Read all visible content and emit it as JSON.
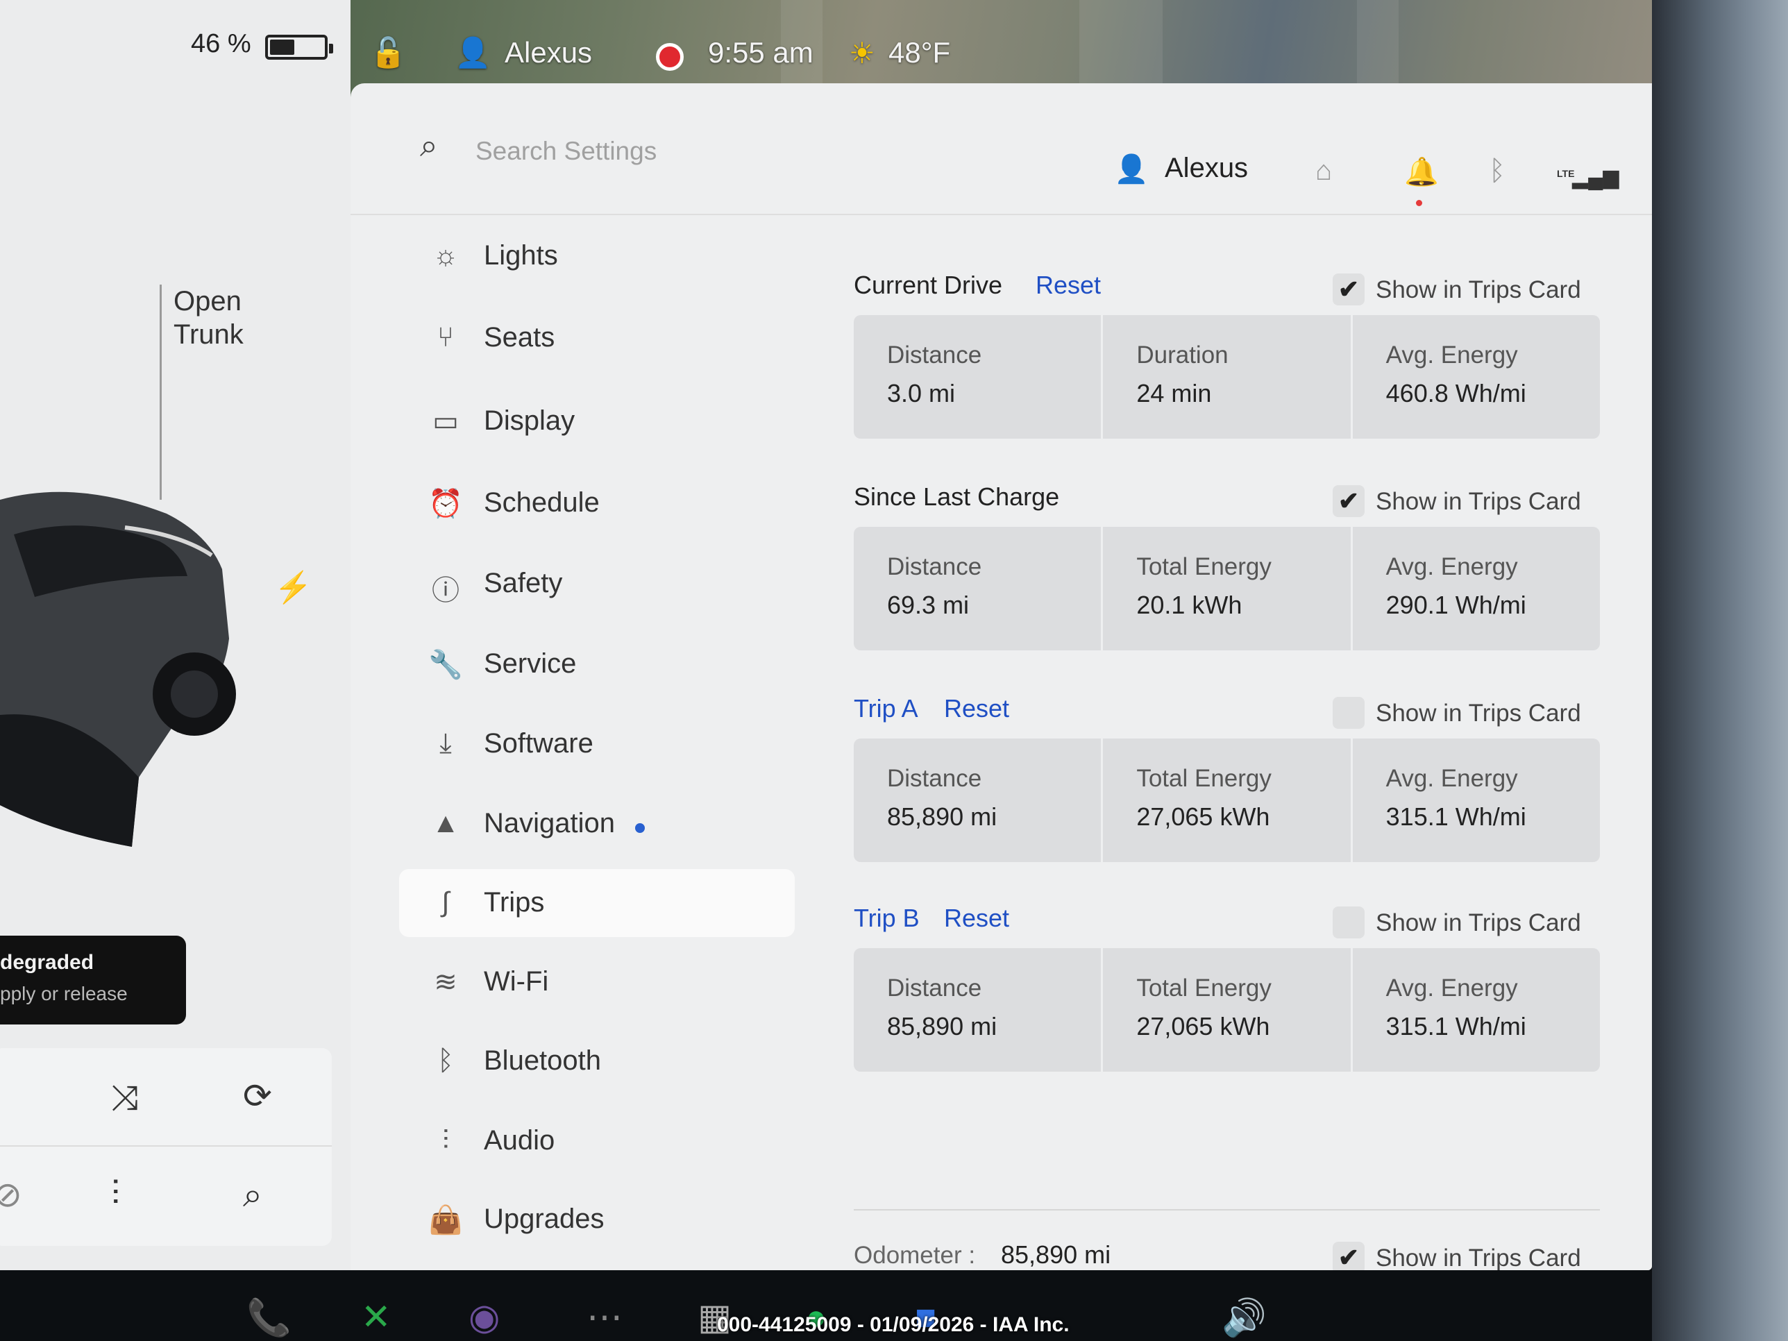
{
  "status": {
    "battery_percent_text": "46 %",
    "battery_level": 0.46,
    "user_name": "Alexus",
    "time": "9:55 am",
    "temperature": "48°F"
  },
  "left_panel": {
    "trunk_label": "Open\nTrunk",
    "alert_line1": "degraded",
    "alert_line2": "pply or release"
  },
  "search": {
    "placeholder": "Search Settings"
  },
  "profile": {
    "name": "Alexus",
    "network": "LTE"
  },
  "menu": {
    "items": [
      {
        "label": "Lights",
        "icon": "light-icon"
      },
      {
        "label": "Seats",
        "icon": "seat-icon"
      },
      {
        "label": "Display",
        "icon": "display-icon"
      },
      {
        "label": "Schedule",
        "icon": "alarm-clock-icon"
      },
      {
        "label": "Safety",
        "icon": "alert-circle-icon"
      },
      {
        "label": "Service",
        "icon": "wrench-icon"
      },
      {
        "label": "Software",
        "icon": "download-icon"
      },
      {
        "label": "Navigation",
        "icon": "navigation-arrow-icon"
      },
      {
        "label": "Trips",
        "icon": "trips-icon"
      },
      {
        "label": "Wi-Fi",
        "icon": "wifi-icon"
      },
      {
        "label": "Bluetooth",
        "icon": "bluetooth-icon"
      },
      {
        "label": "Audio",
        "icon": "equalizer-icon"
      },
      {
        "label": "Upgrades",
        "icon": "shopping-bag-icon"
      }
    ],
    "active": "Trips"
  },
  "trips": {
    "current_drive": {
      "title": "Current Drive",
      "reset": "Reset",
      "show_label": "Show in Trips Card",
      "show_checked": true,
      "stats": [
        {
          "label": "Distance",
          "value": "3.0  mi"
        },
        {
          "label": "Duration",
          "value": "24  min"
        },
        {
          "label": "Avg. Energy",
          "value": "460.8  Wh/mi"
        }
      ]
    },
    "since_last_charge": {
      "title": "Since Last Charge",
      "show_label": "Show in Trips Card",
      "show_checked": true,
      "stats": [
        {
          "label": "Distance",
          "value": "69.3  mi"
        },
        {
          "label": "Total Energy",
          "value": "20.1  kWh"
        },
        {
          "label": "Avg. Energy",
          "value": "290.1  Wh/mi"
        }
      ]
    },
    "trip_a": {
      "title": "Trip A",
      "reset": "Reset",
      "show_label": "Show in Trips Card",
      "show_checked": false,
      "stats": [
        {
          "label": "Distance",
          "value": "85,890  mi"
        },
        {
          "label": "Total Energy",
          "value": "27,065  kWh"
        },
        {
          "label": "Avg. Energy",
          "value": "315.1  Wh/mi"
        }
      ]
    },
    "trip_b": {
      "title": "Trip B",
      "reset": "Reset",
      "show_label": "Show in Trips Card",
      "show_checked": false,
      "stats": [
        {
          "label": "Distance",
          "value": "85,890  mi"
        },
        {
          "label": "Total Energy",
          "value": "27,065  kWh"
        },
        {
          "label": "Avg. Energy",
          "value": "315.1  Wh/mi"
        }
      ]
    },
    "odometer": {
      "label": "Odometer  :",
      "value": "85,890  mi",
      "show_label": "Show in Trips Card",
      "show_checked": true
    }
  },
  "watermark": "000-44125009 - 01/09/2026 - IAA Inc.",
  "colors": {
    "accent_blue": "#1f4fc4",
    "record_red": "#e0282f",
    "phone_green": "#22b14c"
  }
}
